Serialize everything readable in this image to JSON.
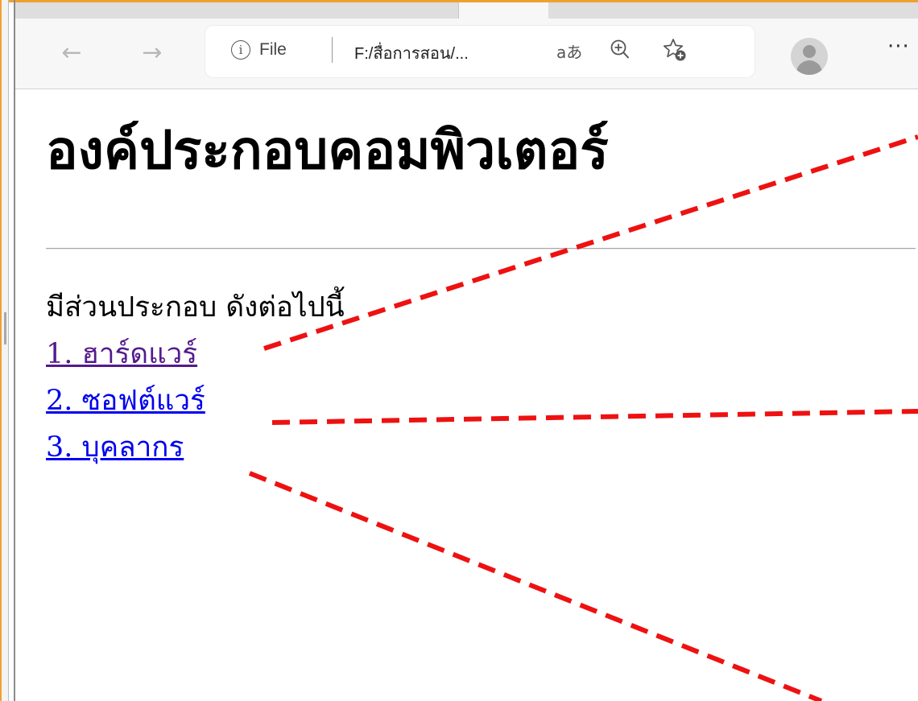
{
  "browser": {
    "address_bar": {
      "info_label": "i",
      "scheme_label": "File",
      "url": "F:/สื่อการสอน/...",
      "reader_label": "aあ"
    },
    "icons": {
      "back": "←",
      "forward": "→",
      "more": "···"
    }
  },
  "page": {
    "title": "องค์ประกอบคอมพิวเตอร์",
    "intro": "มีส่วนประกอบ ดังต่อไปนี้",
    "links": [
      {
        "label": "1. ฮาร์ดแวร์",
        "visited": true
      },
      {
        "label": "2. ซอฟต์แวร์",
        "visited": false
      },
      {
        "label": "3. บุคลากร",
        "visited": false
      }
    ]
  },
  "colors": {
    "link": "#0000ee",
    "visited_link": "#551a8b",
    "annotation": "#ee1111",
    "window_border": "#f0a030"
  }
}
